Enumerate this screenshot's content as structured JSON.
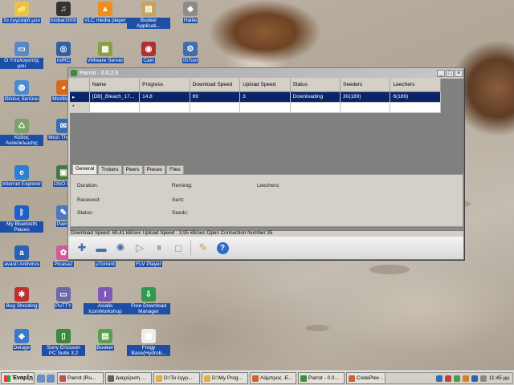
{
  "desktop_icons": [
    {
      "label": "Τα έγγραφά μου",
      "color": "#e7c44c",
      "glyph": "📁"
    },
    {
      "label": "foobar2000",
      "color": "#333333",
      "glyph": "♫"
    },
    {
      "label": "VLC media player",
      "color": "#f28c1a",
      "glyph": "▲"
    },
    {
      "label": "Booker Applicati...",
      "color": "#c7a45a",
      "glyph": "▤"
    },
    {
      "label": "Halite",
      "color": "#8c8c8c",
      "glyph": "◆"
    },
    {
      "label": "Ο Υπολογιστής μου",
      "color": "#5a87c5",
      "glyph": "▭"
    },
    {
      "label": "mIRC",
      "color": "#2f5fa8",
      "glyph": "◎"
    },
    {
      "label": "VMware Server",
      "color": "#8aa040",
      "glyph": "▦"
    },
    {
      "label": "Cain",
      "color": "#b03030",
      "glyph": "◉"
    },
    {
      "label": "ISTool",
      "color": "#3e6fb0",
      "glyph": "⚙"
    },
    {
      "label": "Θέσεις δικτύου",
      "color": "#4b8bd0",
      "glyph": "◍"
    },
    {
      "label": "Mozilla Fi",
      "color": "#d86a1e",
      "glyph": "◕"
    },
    {
      "label": "Κάδος Ανακύκλωσης",
      "color": "#7aa36a",
      "glyph": "♺"
    },
    {
      "label": "Mozi Thunde",
      "color": "#3a6cb0",
      "glyph": "✉"
    },
    {
      "label": "Internet Explorer",
      "color": "#2d7fd3",
      "glyph": "e"
    },
    {
      "label": "OSO Da",
      "color": "#447744",
      "glyph": "▣"
    },
    {
      "label": "My Bluetooth Places",
      "color": "#1e5fc8",
      "glyph": "ᛒ"
    },
    {
      "label": "Paint.",
      "color": "#4a79c0",
      "glyph": "✎"
    },
    {
      "label": "avast! Antivirus",
      "color": "#2a60b6",
      "glyph": "a"
    },
    {
      "label": "Picasa2",
      "color": "#d05a9a",
      "glyph": "✿"
    },
    {
      "label": "µTorrent",
      "color": "#56a83a",
      "glyph": "µ"
    },
    {
      "label": "FLV Player",
      "color": "#3d78c2",
      "glyph": "▶"
    },
    {
      "label": "Bug Shooting",
      "color": "#c03030",
      "glyph": "✱"
    },
    {
      "label": "PuTTY",
      "color": "#6a6aa8",
      "glyph": "▭"
    },
    {
      "label": "Axialis IconWorkshop",
      "color": "#8058b8",
      "glyph": "I"
    },
    {
      "label": "Free Download Manager",
      "color": "#2f9a4f",
      "glyph": "⇩"
    },
    {
      "label": "Deluge",
      "color": "#3a78c8",
      "glyph": "◈"
    },
    {
      "label": "Sony Ericsson PC Suite 3.2",
      "color": "#3a8a3a",
      "glyph": "▯"
    },
    {
      "label": "Booker",
      "color": "#5aa04a",
      "glyph": "▤"
    },
    {
      "label": "Frogy Base(Hydrob...",
      "color": "#ececec",
      "glyph": "▦"
    }
  ],
  "window": {
    "title": "Parrot - 0.0.2.0",
    "buttons": {
      "minimize": "_",
      "maximize": "□",
      "close": "×"
    },
    "columns": [
      "Name",
      "Progress",
      "Download Speed",
      "Upload Speed",
      "Status",
      "Seeders",
      "Leechers"
    ],
    "rows": [
      {
        "marker": "▸",
        "cells": [
          "[DB]_Bleach_17...",
          "14.8",
          "69",
          "3",
          "Downloading",
          "30(189)",
          "6(189)"
        ],
        "selected": true
      },
      {
        "marker": "*",
        "cells": [
          "",
          "",
          "",
          "",
          "",
          "",
          ""
        ],
        "selected": false
      }
    ],
    "tabs": [
      "General",
      "Trckers",
      "Peers",
      "Pieces",
      "Files"
    ],
    "general": {
      "duration_label": "Duration:",
      "remaining_label": "Reminig:",
      "leechers_label": "Leechers:",
      "received_label": "Received:",
      "sent_label": "Sent:",
      "status_label": "Status:",
      "seeds_label": "Seeds:"
    },
    "status_text": "Download Speed: 69,41 kB/sec Upload Speed : 3,95 kB/sec Open Connection Number:35",
    "toolbar_icons": [
      "plus-icon",
      "minus-icon",
      "settings-icon",
      "play-icon",
      "pause-icon",
      "stop-icon",
      "notes-icon",
      "help-icon"
    ]
  },
  "taskbar": {
    "start_label": "Έναρξη",
    "tasks": [
      {
        "label": "Parrot (Ru...",
        "color": "#c05050"
      },
      {
        "label": "Διαχείριση ...",
        "color": "#606060"
      },
      {
        "label": "D:\\To έγγρ...",
        "color": "#e0b040"
      },
      {
        "label": "D:\\My Prog...",
        "color": "#e0b040"
      },
      {
        "label": "Λάμπρος -Ε...",
        "color": "#d06030"
      },
      {
        "label": "Parrot - 0.0...",
        "color": "#3a8f3a"
      },
      {
        "label": "CodePlex - ...",
        "color": "#d06030"
      }
    ],
    "clock": "11:45 μμ"
  }
}
